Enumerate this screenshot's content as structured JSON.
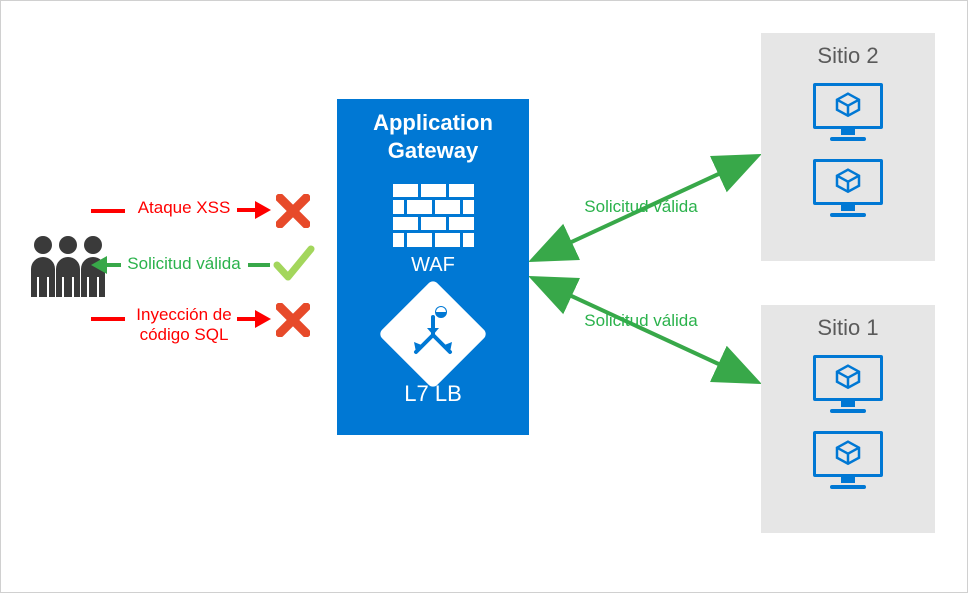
{
  "gateway": {
    "title_line1": "Application",
    "title_line2": "Gateway",
    "waf_label": "WAF",
    "l7_label": "L7 LB"
  },
  "sites": {
    "site1_title": "Sitio 1",
    "site2_title": "Sitio 2"
  },
  "requests": {
    "xss_label": "Ataque XSS",
    "valid_label": "Solicitud válida",
    "sqli_label_line1": "Inyección de",
    "sqli_label_line2": "código SQL",
    "valid_out_label": "Solicitud válida"
  },
  "colors": {
    "azure_blue": "#0078D4",
    "green": "#38a849",
    "red": "#ff0000",
    "xred": "#e74a2a",
    "checkgreen": "#a3d65c",
    "grey_box": "#e6e6e6",
    "grey_text": "#5a5a5a",
    "users": "#3a3a3a"
  }
}
